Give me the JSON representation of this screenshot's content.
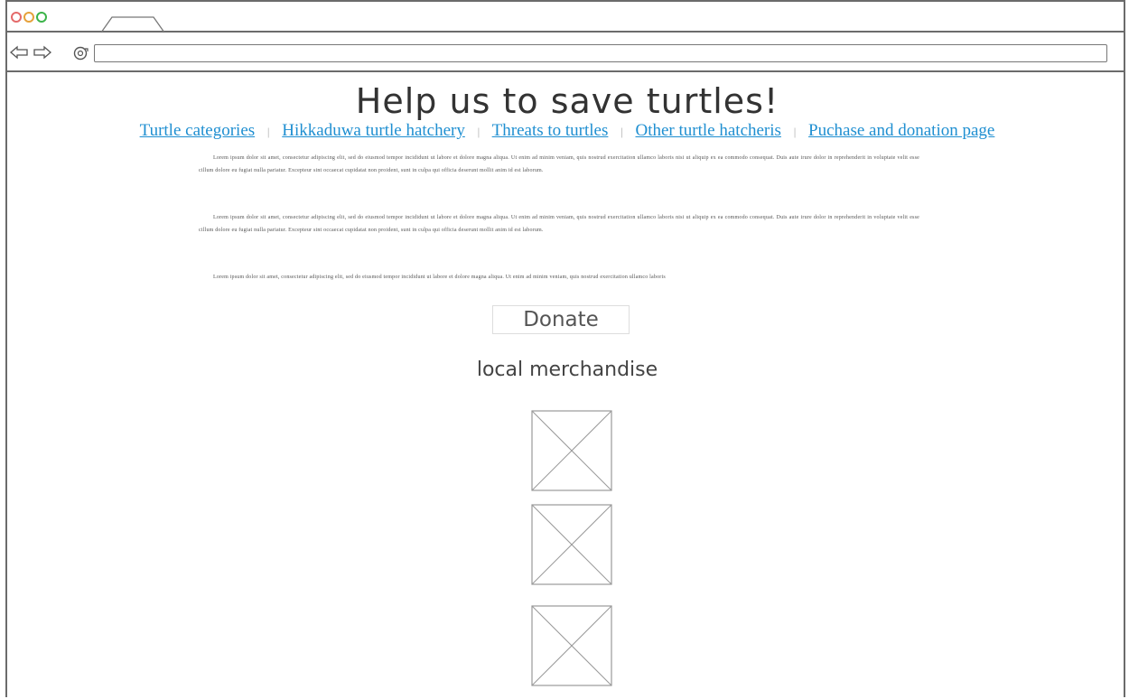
{
  "browser": {
    "address_value": ""
  },
  "page": {
    "title": "Help us to save turtles!",
    "nav_links": [
      "Turtle categories",
      "Hikkaduwa turtle hatchery",
      "Threats to turtles",
      "Other turtle hatcheris",
      "Puchase and donation page"
    ],
    "paragraphs": [
      "Lorem ipsum dolor sit amet, consectetur adipiscing elit, sed do eiusmod tempor incididunt ut labore et dolore magna aliqua. Ut enim ad minim veniam, quis nostrud exercitation ullamco laboris nisi ut aliquip ex ea commodo consequat. Duis aute irure dolor in reprehenderit in voluptate velit esse cillum dolore eu fugiat nulla pariatur. Excepteur sint occaecat cupidatat non proident, sunt in culpa qui officia deserunt mollit anim id est laborum.",
      "Lorem ipsum dolor sit amet, consectetur adipiscing elit, sed do eiusmod tempor incididunt ut labore et dolore magna aliqua. Ut enim ad minim veniam, quis nostrud exercitation ullamco laboris nisi ut aliquip ex ea commodo consequat. Duis aute irure dolor in reprehenderit in voluptate velit esse cillum dolore eu fugiat nulla pariatur. Excepteur sint occaecat cupidatat non proident, sunt in culpa qui officia deserunt mollit anim id est laborum.",
      "Lorem ipsum dolor sit amet, consectetur adipiscing elit, sed do eiusmod tempor incididunt ut labore et dolore magna aliqua. Ut enim ad minim veniam, quis nostrud exercitation ullamco laboris"
    ],
    "donate_label": "Donate",
    "merch_heading": "local merchandise"
  },
  "icons": {
    "back": "back-arrow-icon",
    "forward": "forward-arrow-icon",
    "refresh": "refresh-icon",
    "placeholder": "image-placeholder-icon"
  },
  "colors": {
    "link": "#1f8fd1",
    "dot_red": "#e46a6a",
    "dot_orange": "#e6a13a",
    "dot_green": "#3cb44a"
  }
}
